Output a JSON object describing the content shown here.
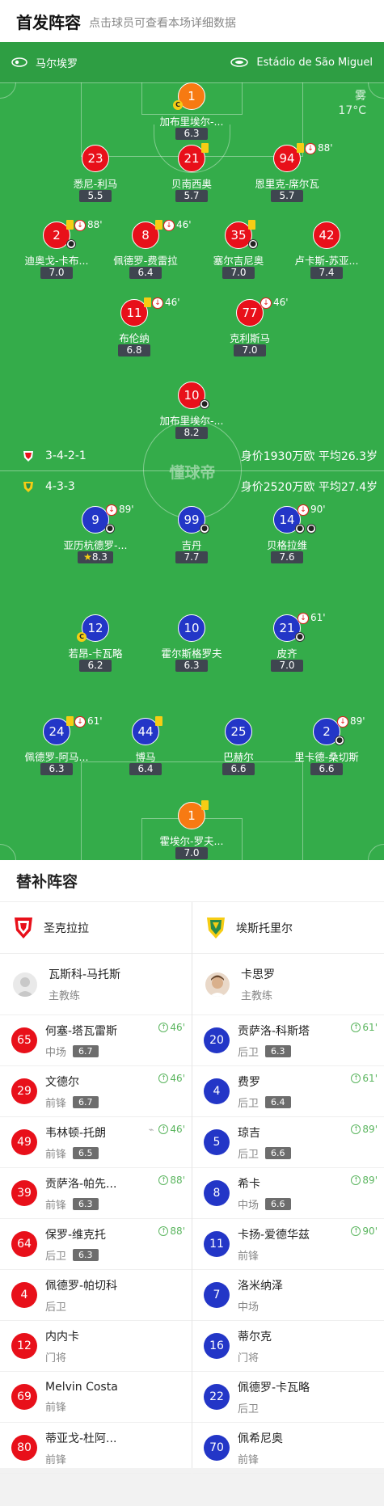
{
  "header": {
    "title": "首发阵容",
    "subtitle": "点击球员可查看本场详细数据"
  },
  "top_team": {
    "name": "马尔埃罗",
    "venue": "Estádio de São Miguel"
  },
  "weather": {
    "condition": "雾",
    "temperature": "17°C"
  },
  "home_formation": {
    "formation": "3-4-2-1",
    "value": "身价1930万欧 平均26.3岁"
  },
  "away_formation": {
    "formation": "4-3-3",
    "value": "身价2520万欧 平均27.4岁"
  },
  "watermark": "懂球帝",
  "home_players": [
    {
      "num": "1",
      "name": "加布里埃尔-...",
      "rating": "6.3"
    },
    {
      "num": "23",
      "name": "悉尼-利马",
      "rating": "5.5"
    },
    {
      "num": "21",
      "name": "贝南西奥",
      "rating": "5.7"
    },
    {
      "num": "94",
      "name": "恩里克-席尔瓦",
      "rating": "5.7",
      "sub_min": "88'"
    },
    {
      "num": "2",
      "name": "迪奥戈-卡布...",
      "rating": "7.0",
      "sub_min": "88'"
    },
    {
      "num": "8",
      "name": "佩德罗-费雷拉",
      "rating": "6.4",
      "sub_min": "46'"
    },
    {
      "num": "35",
      "name": "塞尔吉尼奥",
      "rating": "7.0"
    },
    {
      "num": "42",
      "name": "卢卡斯-苏亚...",
      "rating": "7.4"
    },
    {
      "num": "11",
      "name": "布伦纳",
      "rating": "6.8",
      "sub_min": "46'"
    },
    {
      "num": "77",
      "name": "克利斯马",
      "rating": "7.0",
      "sub_min": "46'"
    },
    {
      "num": "10",
      "name": "加布里埃尔-...",
      "rating": "8.2"
    }
  ],
  "away_players": [
    {
      "num": "9",
      "name": "亚历杭德罗-...",
      "rating": "8.3",
      "sub_min": "89'"
    },
    {
      "num": "99",
      "name": "吉丹",
      "rating": "7.7"
    },
    {
      "num": "14",
      "name": "贝格拉维",
      "rating": "7.6",
      "sub_min": "90'"
    },
    {
      "num": "12",
      "name": "若昂-卡瓦略",
      "rating": "6.2"
    },
    {
      "num": "10",
      "name": "霍尔斯格罗夫",
      "rating": "6.3"
    },
    {
      "num": "21",
      "name": "皮齐",
      "rating": "7.0",
      "sub_min": "61'"
    },
    {
      "num": "24",
      "name": "佩德罗-阿马...",
      "rating": "6.3",
      "sub_min": "61'"
    },
    {
      "num": "44",
      "name": "博马",
      "rating": "6.4"
    },
    {
      "num": "25",
      "name": "巴赫尔",
      "rating": "6.6"
    },
    {
      "num": "2",
      "name": "里卡德-桑切斯",
      "rating": "6.6",
      "sub_min": "89'"
    },
    {
      "num": "1",
      "name": "霍埃尔-罗夫...",
      "rating": "7.0"
    }
  ],
  "subs": {
    "title": "替补阵容",
    "left": {
      "team": "圣克拉拉",
      "coach": {
        "name": "瓦斯科-马托斯",
        "role": "主教练"
      },
      "players": [
        {
          "num": "65",
          "name": "何塞-塔瓦雷斯",
          "pos": "中场",
          "rating": "6.7",
          "in": "46'"
        },
        {
          "num": "29",
          "name": "文德尔",
          "pos": "前锋",
          "rating": "6.7",
          "in": "46'"
        },
        {
          "num": "49",
          "name": "韦林顿-托朗",
          "pos": "前锋",
          "rating": "6.5",
          "in": "46'"
        },
        {
          "num": "39",
          "name": "贡萨洛-帕先...",
          "pos": "前锋",
          "rating": "6.3",
          "in": "88'"
        },
        {
          "num": "64",
          "name": "保罗-维克托",
          "pos": "后卫",
          "rating": "6.3",
          "in": "88'"
        },
        {
          "num": "4",
          "name": "佩德罗-帕切科",
          "pos": "后卫",
          "rating": "",
          "in": ""
        },
        {
          "num": "12",
          "name": "内内卡",
          "pos": "门将",
          "rating": "",
          "in": ""
        },
        {
          "num": "69",
          "name": "Melvin Costa",
          "pos": "前锋",
          "rating": "",
          "in": ""
        },
        {
          "num": "80",
          "name": "蒂亚戈-杜阿...",
          "pos": "前锋",
          "rating": "",
          "in": ""
        }
      ]
    },
    "right": {
      "team": "埃斯托里尔",
      "coach": {
        "name": "卡思罗",
        "role": "主教练"
      },
      "players": [
        {
          "num": "20",
          "name": "贡萨洛-科斯塔",
          "pos": "后卫",
          "rating": "6.3",
          "in": "61'"
        },
        {
          "num": "4",
          "name": "费罗",
          "pos": "后卫",
          "rating": "6.4",
          "in": "61'"
        },
        {
          "num": "5",
          "name": "琼吉",
          "pos": "后卫",
          "rating": "6.6",
          "in": "89'"
        },
        {
          "num": "8",
          "name": "希卡",
          "pos": "中场",
          "rating": "6.6",
          "in": "89'"
        },
        {
          "num": "11",
          "name": "卡扬-爱德华兹",
          "pos": "前锋",
          "rating": "",
          "in": "90'"
        },
        {
          "num": "7",
          "name": "洛米纳泽",
          "pos": "中场",
          "rating": "",
          "in": ""
        },
        {
          "num": "16",
          "name": "蒂尔克",
          "pos": "门将",
          "rating": "",
          "in": ""
        },
        {
          "num": "22",
          "name": "佩德罗-卡瓦略",
          "pos": "后卫",
          "rating": "",
          "in": ""
        },
        {
          "num": "70",
          "name": "佩希尼奥",
          "pos": "前锋",
          "rating": "",
          "in": ""
        }
      ]
    }
  }
}
